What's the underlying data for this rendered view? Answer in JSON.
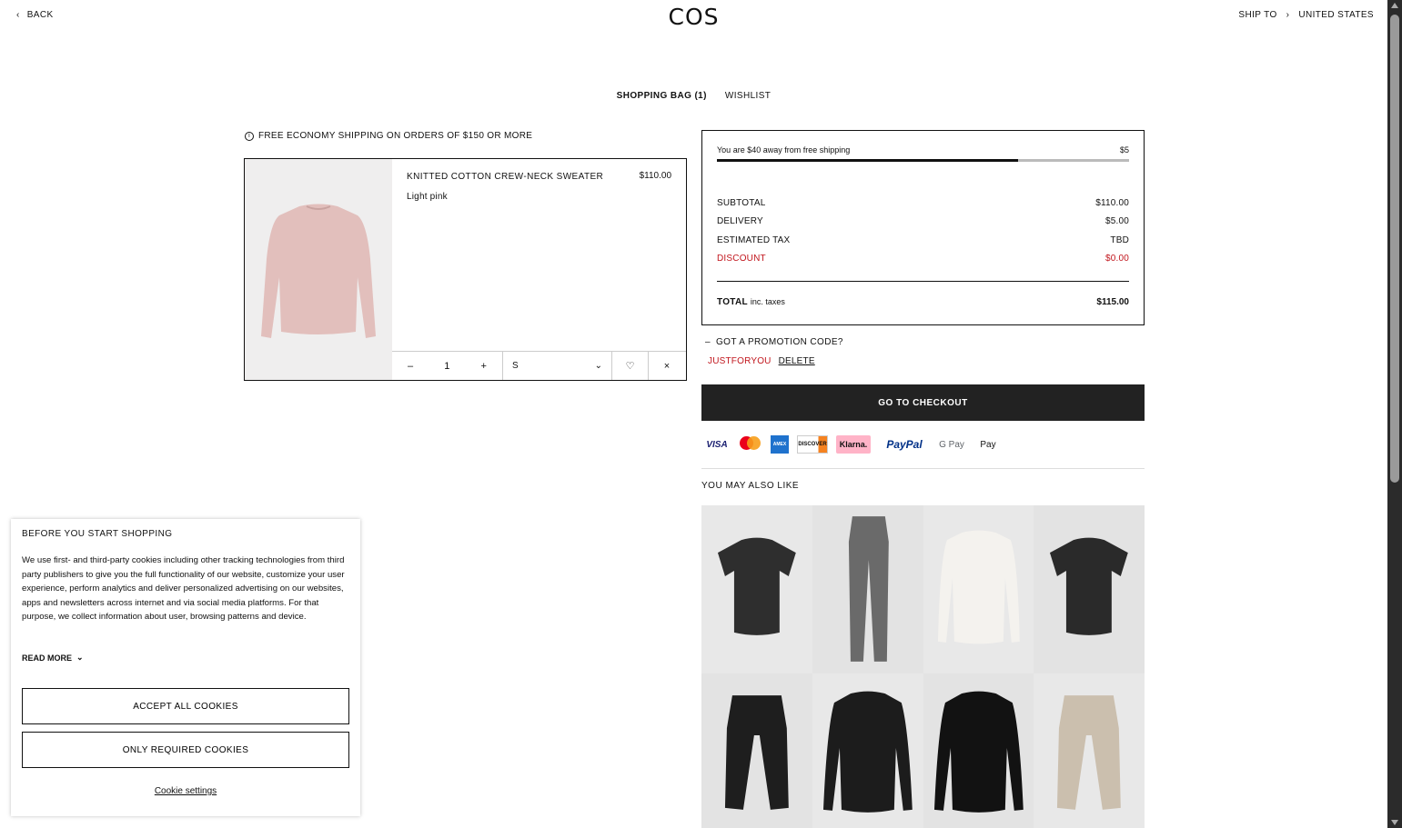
{
  "header": {
    "back_label": "BACK",
    "logo": "COS",
    "ship_to_label": "SHIP TO",
    "ship_to_country": "UNITED STATES"
  },
  "tabs": [
    {
      "label": "SHOPPING BAG (1)",
      "active": true
    },
    {
      "label": "WISHLIST",
      "active": false
    }
  ],
  "shipping_note": "FREE ECONOMY SHIPPING ON ORDERS OF $150 OR MORE",
  "cart_item": {
    "name": "KNITTED COTTON CREW-NECK SWEATER",
    "price": "$110.00",
    "color": "Light pink",
    "quantity": "1",
    "size": "S",
    "image_color": "#e2bfbc"
  },
  "summary": {
    "free_shipping_text": "You are $40 away from free shipping",
    "free_shipping_right": "$5",
    "free_shipping_progress": 0.73,
    "rows": [
      {
        "label": "SUBTOTAL",
        "value": "$110.00"
      },
      {
        "label": "DELIVERY",
        "value": "$5.00"
      },
      {
        "label": "ESTIMATED TAX",
        "value": "TBD"
      },
      {
        "label": "DISCOUNT",
        "value": "$0.00"
      }
    ],
    "total_label": "TOTAL",
    "total_note": "inc. taxes",
    "total_value": "$115.00"
  },
  "promo": {
    "toggle_label": "GOT A PROMOTION CODE?",
    "code": "JUSTFORYOU",
    "delete_label": "DELETE"
  },
  "checkout_label": "GO TO CHECKOUT",
  "payments": {
    "visa": "VISA",
    "amex": "AMEX",
    "discover": "DISCOVER",
    "klarna": "Klarna.",
    "paypal": "PayPal",
    "gpay": "G Pay",
    "applepay": "Pay"
  },
  "also_like_title": "YOU MAY ALSO LIKE",
  "recommendations": [
    {
      "kind": "tshirt",
      "color": "#2e2e2e"
    },
    {
      "kind": "jeans",
      "color": "#6a6a6a"
    },
    {
      "kind": "henley",
      "color": "#f4f2ee"
    },
    {
      "kind": "tshirt",
      "color": "#2a2a2a"
    },
    {
      "kind": "pants",
      "color": "#1e1e1e"
    },
    {
      "kind": "longsleeve",
      "color": "#1c1c1c"
    },
    {
      "kind": "longsleeve",
      "color": "#121212"
    },
    {
      "kind": "pants",
      "color": "#cbbfae"
    }
  ],
  "cookie": {
    "title": "BEFORE YOU START SHOPPING",
    "body": "We use first- and third-party cookies including other tracking technologies from third party publishers to give you the full functionality of our website, customize your user experience, perform analytics and deliver personalized advertising on our websites, apps and newsletters across internet and via social media platforms. For that purpose, we collect information about user, browsing patterns and device.",
    "read_more": "READ MORE",
    "accept_all": "ACCEPT ALL COOKIES",
    "only_required": "ONLY REQUIRED COOKIES",
    "settings": "Cookie settings"
  },
  "colors": {
    "accent_red": "#c1151c",
    "checkout_bg": "#222222"
  }
}
